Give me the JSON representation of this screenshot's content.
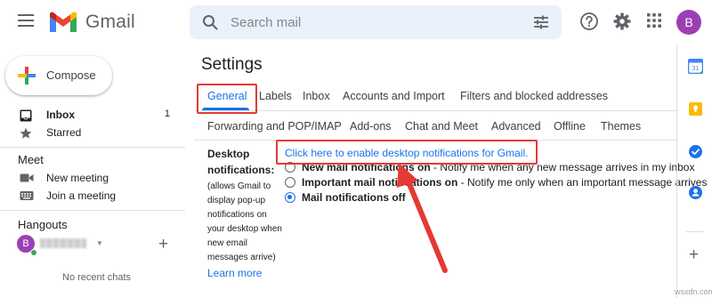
{
  "header": {
    "app_name": "Gmail",
    "search_placeholder": "Search mail",
    "avatar_initial": "B"
  },
  "sidebar": {
    "compose_label": "Compose",
    "items": [
      {
        "label": "Inbox",
        "count": "1"
      },
      {
        "label": "Starred"
      }
    ],
    "meet": {
      "title": "Meet",
      "items": [
        {
          "label": "New meeting"
        },
        {
          "label": "Join a meeting"
        }
      ]
    },
    "hangouts": {
      "title": "Hangouts",
      "avatar_initial": "B",
      "empty_text": "No recent chats"
    }
  },
  "settings": {
    "title": "Settings",
    "tabs_row1": [
      "General",
      "Labels",
      "Inbox",
      "Accounts and Import",
      "Filters and blocked addresses"
    ],
    "tabs_row2": [
      "Forwarding and POP/IMAP",
      "Add-ons",
      "Chat and Meet",
      "Advanced",
      "Offline",
      "Themes"
    ],
    "active_tab": "General",
    "desktop_notifications": {
      "label_line1": "Desktop",
      "label_line2": "notifications:",
      "description": "(allows Gmail to display pop-up notifications on your desktop when new email messages arrive)",
      "learn_more": "Learn more",
      "enable_link": "Click here to enable desktop notifications for Gmail.",
      "options": [
        {
          "bold": "New mail notifications on",
          "rest": " - Notify me when any new message arrives in my inbox",
          "checked": false
        },
        {
          "bold": "Important mail notifications on",
          "rest": " - Notify me only when an important message arrives",
          "checked": false
        },
        {
          "bold": "Mail notifications off",
          "rest": "",
          "checked": true
        }
      ]
    }
  },
  "watermark": "wsxdn.com",
  "colors": {
    "accent": "#1a73e8",
    "annotation_red": "#e53935",
    "avatar": "#9c3fb5"
  }
}
